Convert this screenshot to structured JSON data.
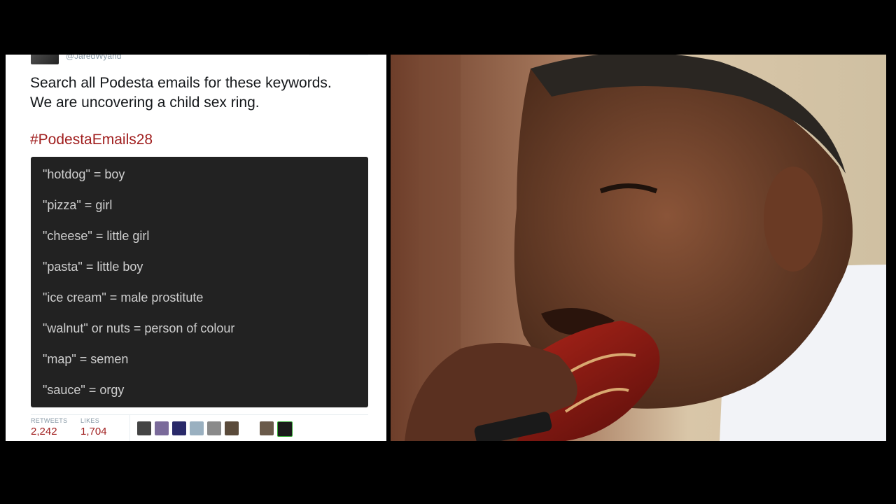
{
  "tweet": {
    "handle": "@JaredWyand",
    "text_lines": [
      "Search all Podesta emails for these keywords.",
      "We are uncovering a child sex ring."
    ],
    "hashtag": "#PodestaEmails28",
    "keywords": [
      "\"hotdog\" = boy",
      "\"pizza\" = girl",
      "\"cheese\" = little girl",
      "\"pasta\" = little boy",
      "\"ice cream\" = male prostitute",
      "\"walnut\" or nuts = person of colour",
      "\"map\" = semen",
      "\"sauce\" = orgy"
    ],
    "stats": {
      "retweets_label": "RETWEETS",
      "retweets_value": "2,242",
      "likes_label": "LIKES",
      "likes_value": "1,704"
    },
    "colors": {
      "accent": "#a01e1e",
      "code_bg": "#222222",
      "code_text": "#cfcfcf"
    }
  },
  "photo": {
    "icons": [
      "person-photo"
    ]
  }
}
